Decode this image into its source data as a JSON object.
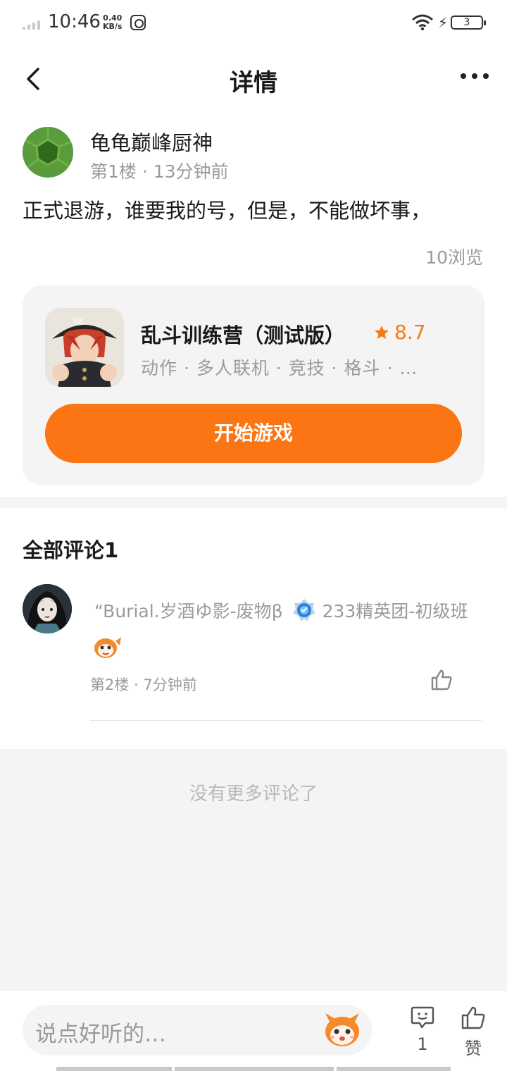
{
  "status_bar": {
    "time": "10:46",
    "speed_value": "0.40",
    "speed_unit": "KB/s",
    "battery": "3"
  },
  "header": {
    "title": "详情"
  },
  "post": {
    "author": "龟龟巅峰厨神",
    "meta": "第1楼 · 13分钟前",
    "body": "正式退游，谁要我的号，但是，不能做坏事，",
    "views": "10浏览"
  },
  "game_card": {
    "name": "乱斗训练营（测试版）",
    "rating": "8.7",
    "tags": "动作 · 多人联机 · 竞技 · 格斗 · …",
    "start_button": "开始游戏"
  },
  "comments": {
    "header": "全部评论1",
    "items": [
      {
        "prefix": "“Burial.岁酒ゆ影-废物β",
        "group": "233精英团-初级班",
        "meta": "第2楼 · 7分钟前"
      }
    ],
    "end_text": "没有更多评论了"
  },
  "bottom_bar": {
    "placeholder": "说点好听的…",
    "comment_count": "1",
    "like_label": "赞"
  },
  "colors": {
    "accent": "#fb7515",
    "muted_text": "#9a9a9a",
    "card_bg": "#f4f4f4"
  }
}
